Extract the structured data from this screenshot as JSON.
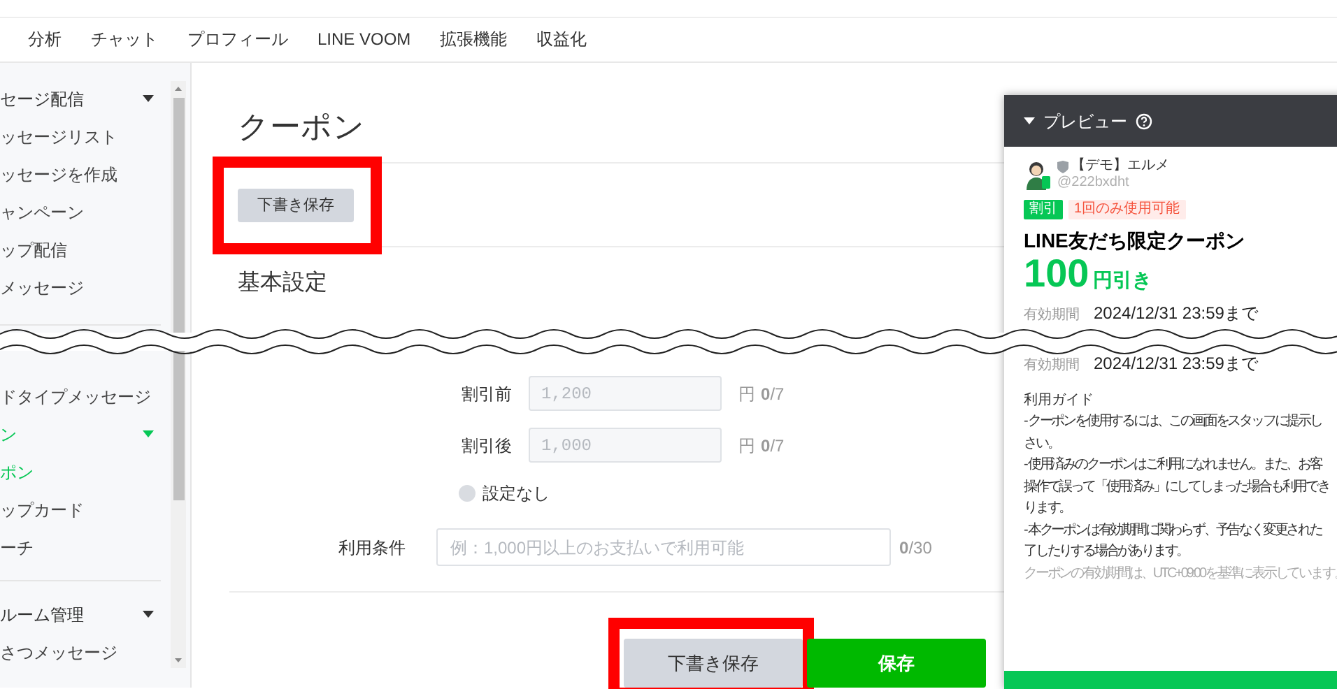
{
  "nav": {
    "tabs": [
      {
        "label": "分析",
        "selected": false
      },
      {
        "label": "チャット",
        "selected": false
      },
      {
        "label": "プロフィール",
        "selected": false
      },
      {
        "label": "LINE VOOM",
        "selected": false
      },
      {
        "label": "拡張機能",
        "selected": false
      },
      {
        "label": "収益化",
        "selected": false
      }
    ]
  },
  "sidebar": {
    "upper": [
      {
        "kind": "section",
        "label": "セージ配信",
        "active": false,
        "expanded": true
      },
      {
        "kind": "link",
        "label": "ッセージリスト",
        "selected": false
      },
      {
        "kind": "link",
        "label": "ッセージを作成",
        "selected": false
      },
      {
        "kind": "link",
        "label": "ャンペーン",
        "selected": false
      },
      {
        "kind": "link",
        "label": "ップ配信",
        "selected": false
      },
      {
        "kind": "link",
        "label": "メッセージ",
        "selected": false
      }
    ],
    "lower": [
      {
        "kind": "link",
        "label": "ドタイプメッセージ",
        "selected": false
      },
      {
        "kind": "section",
        "label": "ン",
        "active": true,
        "expanded": true
      },
      {
        "kind": "link",
        "label": "ポン",
        "selected": true
      },
      {
        "kind": "link",
        "label": "ップカード",
        "selected": false
      },
      {
        "kind": "link",
        "label": "ーチ",
        "selected": false
      },
      {
        "kind": "divider"
      },
      {
        "kind": "section",
        "label": "ルーム管理",
        "active": false,
        "expanded": true
      },
      {
        "kind": "link",
        "label": "さつメッセージ",
        "selected": false
      }
    ]
  },
  "page": {
    "title": "クーポン",
    "draft_button": {
      "label": "下書き保存",
      "highlighted": true
    },
    "section_title": "基本設定"
  },
  "discount": {
    "fields": [
      {
        "label": "割引前",
        "placeholder": "1,200",
        "unit": "円",
        "count": "**0**/7"
      },
      {
        "label": "割引後",
        "placeholder": "1,000",
        "unit": "円",
        "count": "**0**/7"
      }
    ],
    "none_option": {
      "label": "設定なし",
      "selected": false
    }
  },
  "usage_condition": {
    "label": "利用条件",
    "placeholder": "例：1,000円以上のお支払いで利用可能",
    "count": "**0**/30"
  },
  "footer_buttons": [
    {
      "kind": "secondary",
      "label": "下書き保存",
      "highlighted": true
    },
    {
      "kind": "primary",
      "label": "保存",
      "highlighted": false
    }
  ],
  "preview": {
    "title": "プレビュー",
    "account": {
      "name": "【デモ】エルメ",
      "id": "@222bxdht"
    },
    "badges": [
      {
        "kind": "category",
        "label": "割引"
      },
      {
        "kind": "limit",
        "label": "1回のみ使用可能"
      }
    ],
    "coupon_title": "LINE友だち限定クーポン",
    "amount": "100",
    "amount_unit": "円引き",
    "validity_upper": {
      "label": "有効期間",
      "value": "2024/12/31 23:59まで"
    },
    "validity_lower": {
      "label": "有効期間",
      "value": "2024/12/31 23:59まで"
    },
    "guide_title": "利用ガイド",
    "guide_lines": [
      "- クーポンを使用するには、この画面をスタッフに提示し",
      "さい。",
      "- 使用済みのクーポンはご利用になれません。また、お客",
      "操作で誤って「使用済み」にしてしまった場合も利用でき",
      "ります。",
      "- 本クーポンは有効期間に関わらず、予告なく変更された",
      "了したりする場合があります。"
    ],
    "note": "クーポンの有効期間は、UTC+09:00を基準に表示しています。"
  }
}
